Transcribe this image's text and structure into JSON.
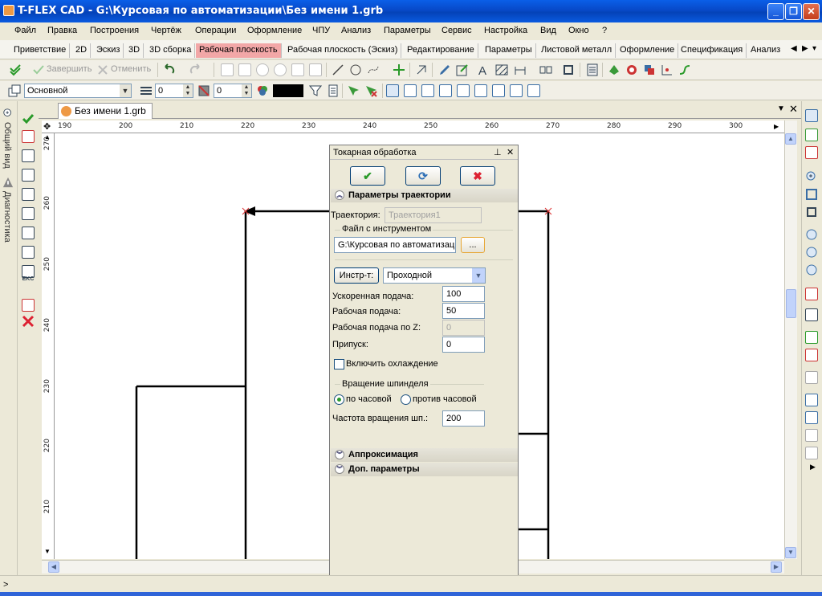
{
  "window": {
    "title": "T-FLEX CAD - G:\\Курсовая по автоматизации\\Без имени 1.grb"
  },
  "menu": [
    "Файл",
    "Правка",
    "Построения",
    "Чертёж",
    "Операции",
    "Оформление",
    "ЧПУ",
    "Анализ",
    "Параметры",
    "Сервис",
    "Настройка",
    "Вид",
    "Окно",
    "?"
  ],
  "ribbon_tabs": [
    "Приветствие",
    "2D",
    "Эскиз",
    "3D",
    "3D сборка",
    "Рабочая плоскость",
    "Рабочая плоскость (Эскиз)",
    "Редактирование",
    "Параметры",
    "Листовой металл",
    "Оформление",
    "Спецификация",
    "Анализ"
  ],
  "ribbon_active": "Рабочая плоскость",
  "toolbar1": {
    "finish": "Завершить",
    "cancel": "Отменить"
  },
  "toolbar2": {
    "layer": "Основной",
    "level1": "0",
    "level2": "0"
  },
  "left_panel": {
    "tab1": "Общий вид",
    "tab2": "Диагностика"
  },
  "document": {
    "tab": "Без имени 1.grb"
  },
  "ruler": {
    "top": [
      "190",
      "200",
      "210",
      "220",
      "230",
      "240",
      "250",
      "260",
      "270",
      "280",
      "290",
      "300"
    ],
    "left": [
      "270",
      "260",
      "250",
      "240",
      "230",
      "220",
      "210"
    ]
  },
  "dialog": {
    "title": "Токарная обработка",
    "ok": "✔",
    "refresh": "⟳",
    "cancel": "✖",
    "section_trajectory": "Параметры траектории",
    "trajectory_label": "Траектория:",
    "trajectory_value": "Траектория1",
    "tool_file_group": "Файл с инструментом",
    "tool_file_value": "G:\\Курсовая по автоматизаци",
    "browse": "...",
    "tool_button": "Инстр-т:",
    "tool_value": "Проходной",
    "rapid_feed_label": "Ускоренная подача:",
    "rapid_feed_value": "100",
    "work_feed_label": "Рабочая подача:",
    "work_feed_value": "50",
    "work_feed_z_label": "Рабочая подача по Z:",
    "work_feed_z_value": "0",
    "allowance_label": "Припуск:",
    "allowance_value": "0",
    "cooling_label": "Включить охлаждение",
    "spindle_group": "Вращение шпинделя",
    "cw_label": "по часовой",
    "ccw_label": "против часовой",
    "spindle_speed_label": "Частота вращения шп.:",
    "spindle_speed_value": "200",
    "section_approx": "Аппроксимация",
    "section_extra": "Доп. параметры"
  },
  "status": {
    "text": ">"
  },
  "colors": {
    "title_bar": "#0A5FE8",
    "active_tab": "#F2A7A7",
    "canvas": "#FFFFFF"
  }
}
